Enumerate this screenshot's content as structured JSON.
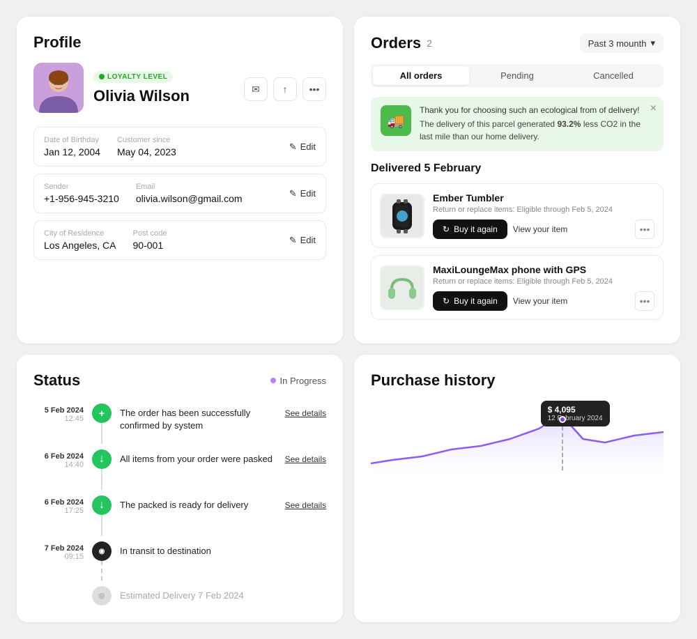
{
  "profile": {
    "title": "Profile",
    "loyalty_badge": "LOYALTY LEVEL",
    "name": "Olivia Wilson",
    "dob_label": "Date of Birthday",
    "dob_value": "Jan 12, 2004",
    "customer_since_label": "Customer since",
    "customer_since_value": "May 04, 2023",
    "sender_label": "Sender",
    "sender_value": "+1-956-945-3210",
    "email_label": "Email",
    "email_value": "olivia.wilson@gmail.com",
    "city_label": "City of Residence",
    "city_value": "Los Angeles, CA",
    "postcode_label": "Post code",
    "postcode_value": "90-001",
    "edit_label": "Edit"
  },
  "status": {
    "title": "Status",
    "status_text": "In Progress",
    "items": [
      {
        "date": "5 Feb 2024",
        "time": "12:45",
        "icon": "+",
        "color": "#22c55e",
        "text": "The order has been successfully confirmed by system",
        "link": "See details",
        "line_type": "solid"
      },
      {
        "date": "6 Feb 2024",
        "time": "14:40",
        "icon": "↓",
        "color": "#22c55e",
        "text": "All items from your order were pasked",
        "link": "See details",
        "line_type": "solid"
      },
      {
        "date": "6 Feb 2024",
        "time": "17:25",
        "icon": "↓",
        "color": "#22c55e",
        "text": "The packed is ready for delivery",
        "link": "See details",
        "line_type": "solid"
      },
      {
        "date": "7 Feb 2024",
        "time": "09:15",
        "icon": "◉",
        "color": "#222",
        "text": "In transit to destination",
        "link": "",
        "line_type": "dashed"
      },
      {
        "date": "",
        "time": "",
        "icon": "◎",
        "color": "#bbb",
        "text": "Estimated Delivery 7 Feb 2024",
        "link": "",
        "line_type": "none"
      }
    ]
  },
  "orders": {
    "title": "Orders",
    "count": "2",
    "filter_label": "Past 3 mounth",
    "tabs": [
      {
        "label": "All orders",
        "active": true
      },
      {
        "label": "Pending",
        "active": false
      },
      {
        "label": "Cancelled",
        "active": false
      }
    ],
    "eco_banner": {
      "title": "Thank you for choosing such an ecological from of delivery!",
      "desc_pre": "The delivery of this parcel generated ",
      "highlight": "93.2%",
      "desc_mid": " less CO2",
      "desc_post": " in the last mile than our home delivery."
    },
    "delivered_label": "Delivered",
    "delivered_date": "5 February",
    "items": [
      {
        "name": "Ember Tumbler",
        "return_text": "Return or replace items: Eligible through Feb 5, 2024",
        "buy_again": "Buy it again",
        "view_item": "View your item"
      },
      {
        "name": "MaxiLoungeMax phone with GPS",
        "return_text": "Return or replace items: Eligible through Feb 5, 2024",
        "buy_again": "Buy it again",
        "view_item": "View your item"
      }
    ]
  },
  "purchase_history": {
    "title": "Purchase history",
    "tooltip_amount": "$ 4,095",
    "tooltip_date": "12 February 2024",
    "chart_color": "#8b5cf6",
    "chart_fill": "#ede9fe"
  },
  "icons": {
    "email": "✉",
    "share": "↑",
    "more": "•••",
    "edit_pencil": "✎",
    "chevron_down": "▾",
    "refresh": "↻",
    "close": "×",
    "truck": "🚚"
  }
}
